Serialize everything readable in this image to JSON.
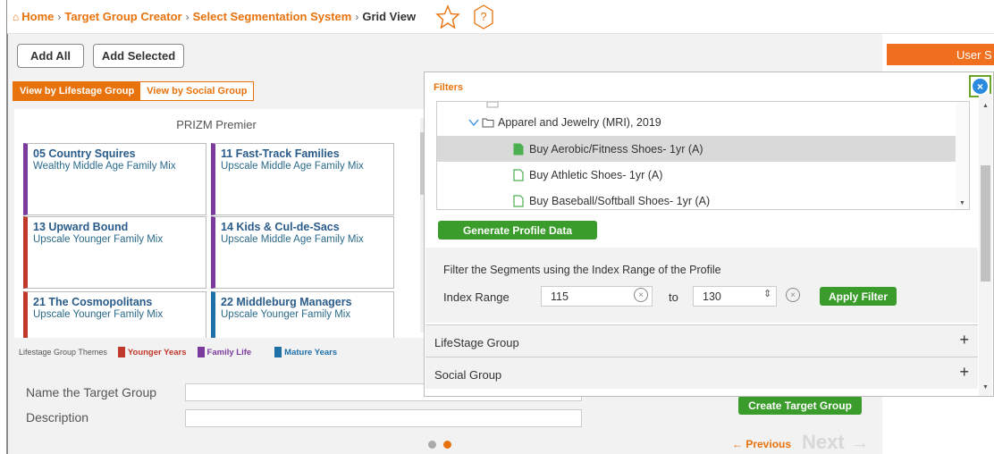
{
  "breadcrumb": {
    "home": "Home",
    "items": [
      "Target Group Creator",
      "Select Segmentation System"
    ],
    "current": "Grid View"
  },
  "toolbar": {
    "add_all": "Add All",
    "add_selected": "Add Selected"
  },
  "view_toggle": {
    "active": "View by Lifestage Group",
    "inactive": "View by Social Group"
  },
  "grid": {
    "title": "PRIZM Premier",
    "cards": [
      {
        "name": "05 Country Squires",
        "desc": "Wealthy Middle Age Family Mix",
        "color": "#7b3a9c"
      },
      {
        "name": "11 Fast-Track Families",
        "desc": "Upscale Middle Age Family Mix",
        "color": "#7b3a9c"
      },
      {
        "name": "13 Upward Bound",
        "desc": "Upscale Younger Family Mix",
        "color": "#c0392b"
      },
      {
        "name": "14 Kids & Cul-de-Sacs",
        "desc": "Upscale Middle Age Family Mix",
        "color": "#7b3a9c"
      },
      {
        "name": "21 The Cosmopolitans",
        "desc": "Upscale Younger Family Mix",
        "color": "#c0392b"
      },
      {
        "name": "22 Middleburg Managers",
        "desc": "Upscale Younger Family Mix",
        "color": "#1f6fa8"
      }
    ]
  },
  "legend": {
    "title": "Lifestage Group Themes",
    "items": [
      {
        "label": "Younger Years",
        "color": "#c0392b"
      },
      {
        "label": "Family Life",
        "color": "#7b3a9c"
      },
      {
        "label": "Mature Years",
        "color": "#1f6fa8"
      }
    ]
  },
  "form": {
    "name_label": "Name the Target Group",
    "desc_label": "Description"
  },
  "actions": {
    "create": "Create Target Group",
    "previous": "← Previous",
    "next": "Next →"
  },
  "user_tab": "User S",
  "filters": {
    "title": "Filters",
    "tree": {
      "category": "Apparel and Jewelry (MRI), 2019",
      "items": [
        {
          "label": "Buy Aerobic/Fitness Shoes- 1yr (A)",
          "selected": true
        },
        {
          "label": "Buy Athletic Shoes- 1yr (A)",
          "selected": false
        },
        {
          "label": "Buy Baseball/Softball Shoes- 1yr (A)",
          "selected": false
        }
      ]
    },
    "generate": "Generate Profile Data",
    "range_text": "Filter the Segments using the Index Range of the Profile",
    "index_label": "Index Range",
    "from_value": "115",
    "to_label": "to",
    "to_value": "130",
    "apply": "Apply Filter",
    "sections": [
      "LifeStage Group",
      "Social Group"
    ]
  },
  "colors": {
    "accent": "#e8720c",
    "green": "#3a9c2a"
  }
}
